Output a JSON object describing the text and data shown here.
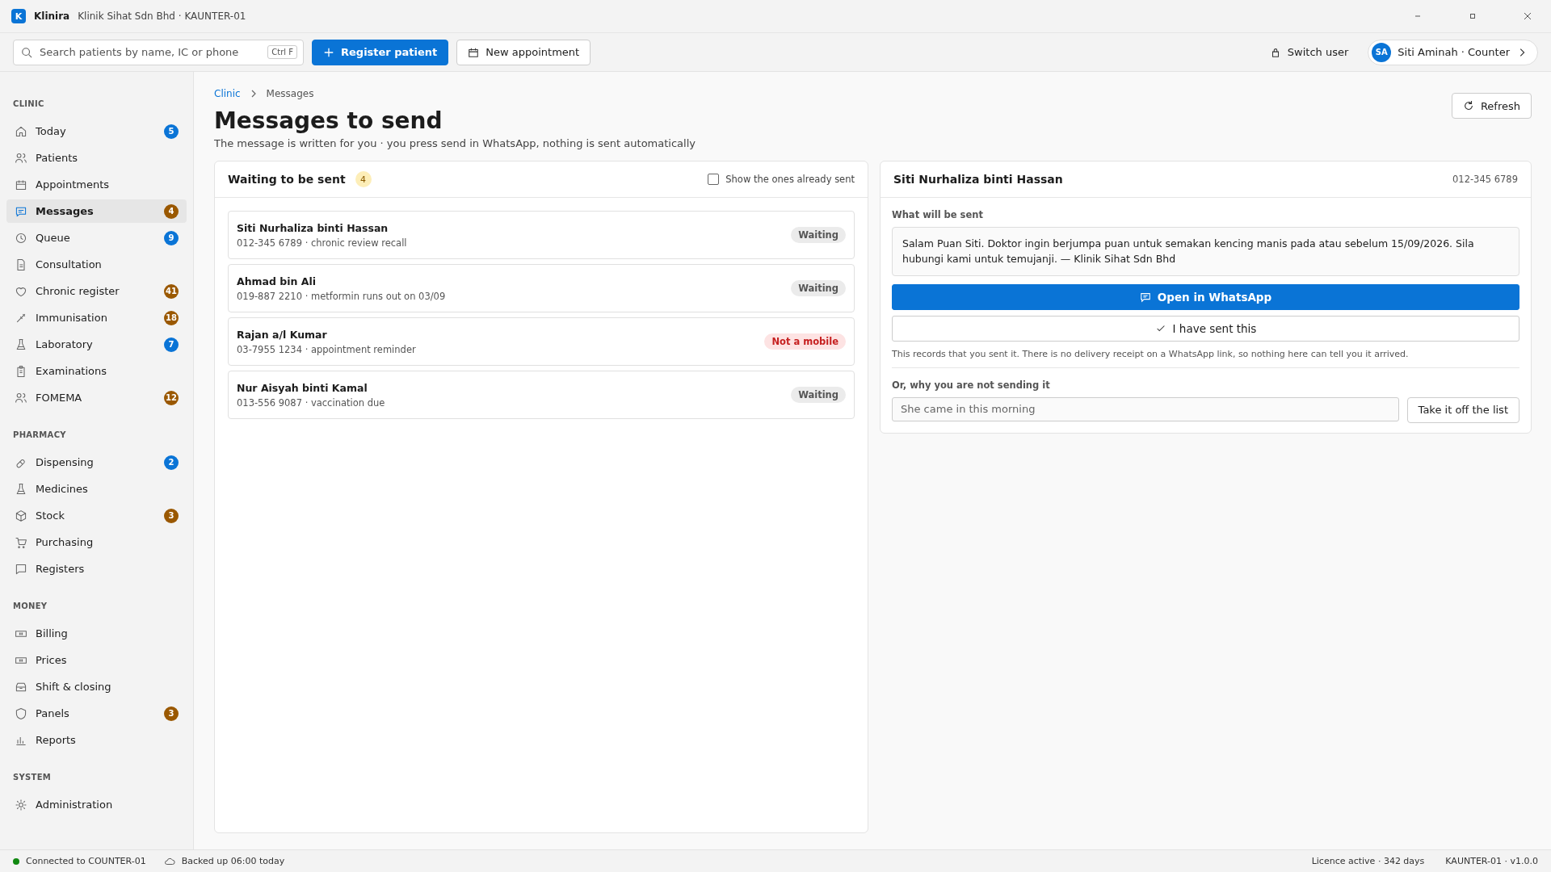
{
  "window": {
    "app": "Klinira",
    "logo": "K",
    "title": "Klinik Sihat Sdn Bhd · KAUNTER-01"
  },
  "toolbar": {
    "search": {
      "placeholder": "Search patients by name, IC or phone",
      "shortcut": "Ctrl F"
    },
    "primary_button": "Register patient",
    "secondary_button": "New appointment",
    "switch_user": "Switch user",
    "user": {
      "initials": "SA",
      "label": "Siti Aminah · Counter"
    }
  },
  "sidebar": {
    "sections": [
      {
        "title": "CLINIC",
        "items": [
          {
            "label": "Today",
            "selected": false,
            "badge": "5",
            "color": "#0a74d6"
          },
          {
            "label": "Patients",
            "selected": false
          },
          {
            "label": "Appointments",
            "selected": false
          },
          {
            "label": "Messages",
            "selected": true,
            "badge": "4",
            "color": "#9a5800"
          },
          {
            "label": "Queue",
            "selected": false,
            "badge": "9",
            "color": "#0a74d6"
          },
          {
            "label": "Consultation",
            "selected": false
          },
          {
            "label": "Chronic register",
            "selected": false,
            "badge": "41",
            "color": "#9a5800"
          },
          {
            "label": "Immunisation",
            "selected": false,
            "badge": "18",
            "color": "#9a5800"
          },
          {
            "label": "Laboratory",
            "selected": false,
            "badge": "7",
            "color": "#0a74d6"
          },
          {
            "label": "Examinations",
            "selected": false
          },
          {
            "label": "FOMEMA",
            "selected": false,
            "badge": "12",
            "color": "#9a5800"
          }
        ]
      },
      {
        "title": "PHARMACY",
        "items": [
          {
            "label": "Dispensing",
            "selected": false,
            "badge": "2",
            "color": "#0a74d6"
          },
          {
            "label": "Medicines",
            "selected": false
          },
          {
            "label": "Stock",
            "selected": false,
            "badge": "3",
            "color": "#9a5800"
          },
          {
            "label": "Purchasing",
            "selected": false
          },
          {
            "label": "Registers",
            "selected": false
          }
        ]
      },
      {
        "title": "MONEY",
        "items": [
          {
            "label": "Billing",
            "selected": false
          },
          {
            "label": "Prices",
            "selected": false
          },
          {
            "label": "Shift & closing",
            "selected": false
          },
          {
            "label": "Panels",
            "selected": false,
            "badge": "3",
            "color": "#9a5800"
          },
          {
            "label": "Reports",
            "selected": false
          }
        ]
      },
      {
        "title": "SYSTEM",
        "items": [
          {
            "label": "Administration",
            "selected": false
          }
        ]
      }
    ]
  },
  "breadcrumb": [
    "Clinic",
    "Messages"
  ],
  "refresh_button": "Refresh",
  "page_title": "Messages to send",
  "page_subtitle": "The message is written for you · you press send in WhatsApp, nothing is sent automatically",
  "queue": {
    "title": "Waiting to be sent",
    "count": "4",
    "show_sent": {
      "label": "Show the ones already sent",
      "checked": false
    },
    "items": [
      {
        "name": "Siti Nurhaliza binti Hassan",
        "detail": "012-345 6789 · chronic review recall",
        "status": "Waiting",
        "kind": "waiting"
      },
      {
        "name": "Ahmad bin Ali",
        "detail": "019-887 2210 · metformin runs out on 03/09",
        "status": "Waiting",
        "kind": "waiting"
      },
      {
        "name": "Rajan a/l Kumar",
        "detail": "03-7955 1234 · appointment reminder",
        "status": "Not a mobile",
        "kind": "error"
      },
      {
        "name": "Nur Aisyah binti Kamal",
        "detail": "013-556 9087 · vaccination due",
        "status": "Waiting",
        "kind": "waiting"
      }
    ]
  },
  "detail": {
    "name": "Siti Nurhaliza binti Hassan",
    "phone": "012-345 6789",
    "message_label": "What will be sent",
    "message": "Salam Puan Siti. Doktor ingin berjumpa puan untuk semakan kencing manis pada atau sebelum 15/09/2026. Sila hubungi kami untuk temujanji. — Klinik Sihat Sdn Bhd",
    "open_button": "Open in WhatsApp",
    "sent_button": "I have sent this",
    "note": "This records that you sent it. There is no delivery receipt on a WhatsApp link, so nothing here can tell you it arrived.",
    "reason_label": "Or, why you are not sending it",
    "reason": {
      "placeholder": "She came in this morning"
    },
    "remove_button": "Take it off the list"
  },
  "status_bar": {
    "connection": "Connected to COUNTER-01",
    "backup": "Backed up 06:00 today",
    "licence": "Licence active · 342 days",
    "version": "KAUNTER-01 · v1.0.0"
  }
}
